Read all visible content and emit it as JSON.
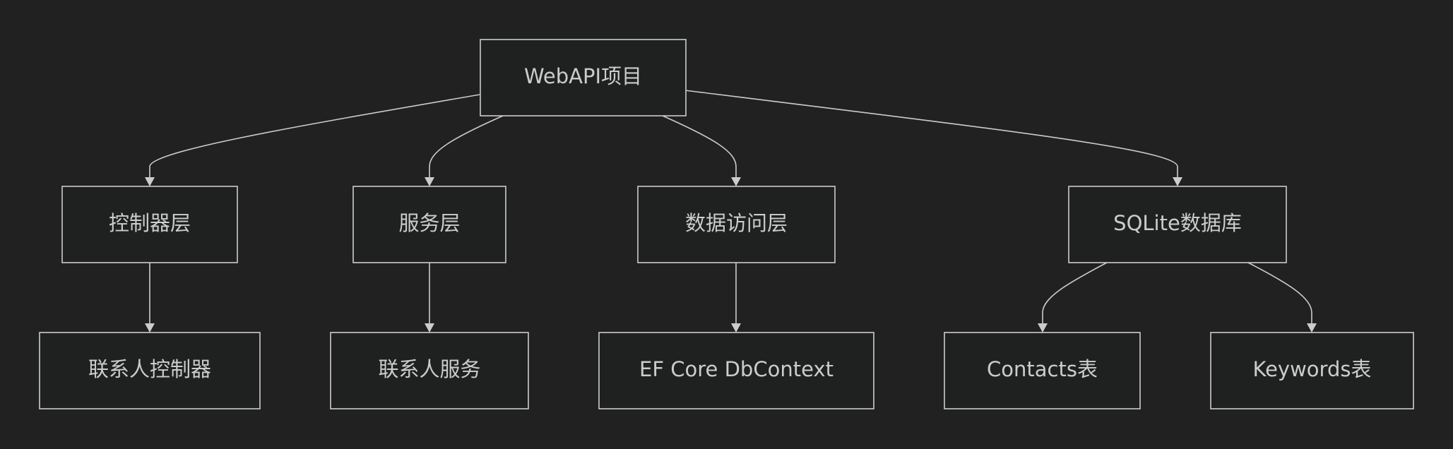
{
  "diagram": {
    "nodes": {
      "webapi": "WebAPI项目",
      "controller_layer": "控制器层",
      "service_layer": "服务层",
      "data_access_layer": "数据访问层",
      "sqlite_db": "SQLite数据库",
      "contact_controller": "联系人控制器",
      "contact_service": "联系人服务",
      "ef_core": "EF Core DbContext",
      "contacts_table": "Contacts表",
      "keywords_table": "Keywords表"
    },
    "edges": [
      [
        "webapi",
        "controller_layer"
      ],
      [
        "webapi",
        "service_layer"
      ],
      [
        "webapi",
        "data_access_layer"
      ],
      [
        "webapi",
        "sqlite_db"
      ],
      [
        "controller_layer",
        "contact_controller"
      ],
      [
        "service_layer",
        "contact_service"
      ],
      [
        "data_access_layer",
        "ef_core"
      ],
      [
        "sqlite_db",
        "contacts_table"
      ],
      [
        "sqlite_db",
        "keywords_table"
      ]
    ]
  }
}
